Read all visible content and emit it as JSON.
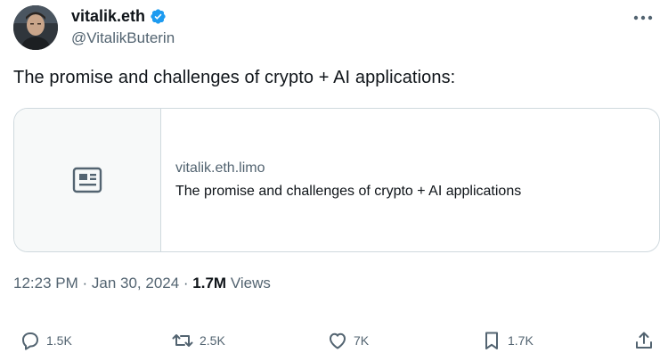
{
  "author": {
    "display_name": "vitalik.eth",
    "handle": "@VitalikButerin",
    "verified_icon": "verified-badge-icon",
    "brand_color": "#1d9bf0"
  },
  "tweet": {
    "text": "The promise and challenges of crypto + AI applications:"
  },
  "link_card": {
    "icon": "article-icon",
    "domain": "vitalik.eth.limo",
    "title": "The promise and challenges of crypto + AI applications"
  },
  "meta": {
    "time": "12:23 PM",
    "separator": " · ",
    "date": "Jan 30, 2024",
    "separator2": " · ",
    "views_count": "1.7M",
    "views_label": " Views"
  },
  "actions": {
    "reply": {
      "icon": "reply-icon",
      "count": "1.5K"
    },
    "retweet": {
      "icon": "retweet-icon",
      "count": "2.5K"
    },
    "like": {
      "icon": "heart-icon",
      "count": "7K"
    },
    "bookmark": {
      "icon": "bookmark-icon",
      "count": "1.7K"
    },
    "share": {
      "icon": "share-icon"
    }
  },
  "colors": {
    "text_primary": "#0f1419",
    "text_secondary": "#536471",
    "border": "#cfd9de"
  }
}
